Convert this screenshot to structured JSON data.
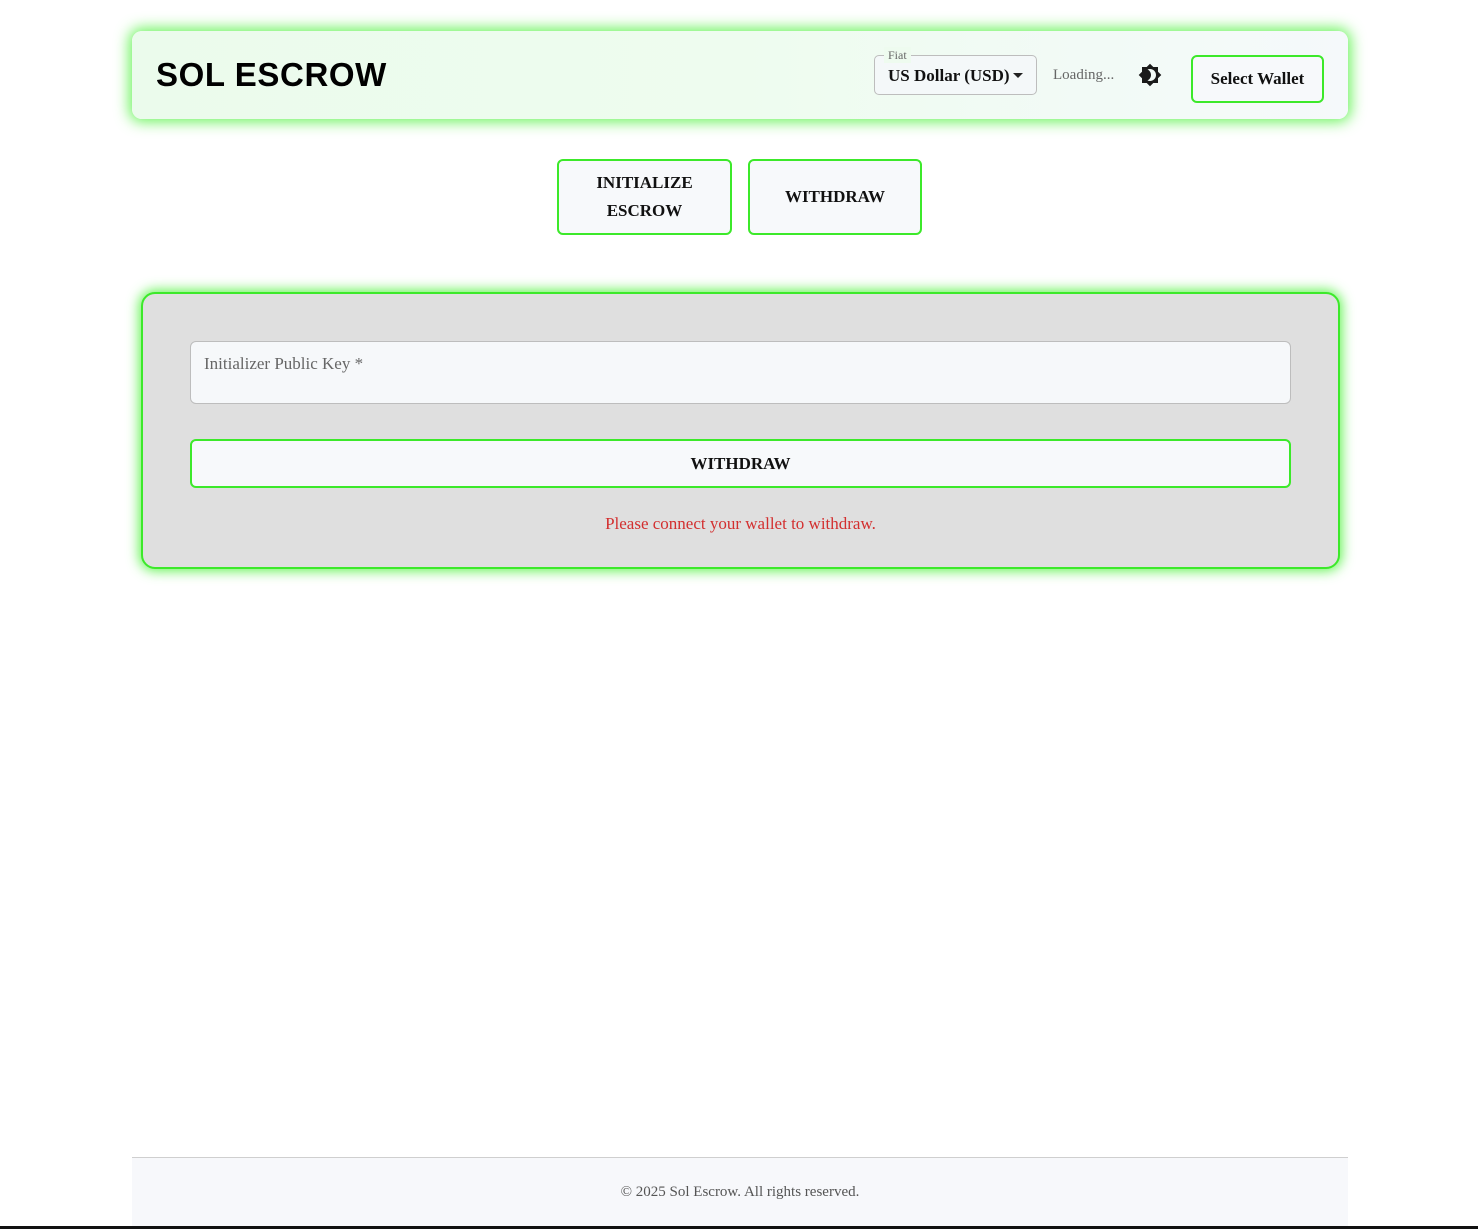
{
  "header": {
    "brand": "SOL ESCROW",
    "fiat": {
      "label": "Fiat",
      "selected": "US Dollar (USD)"
    },
    "price_status": "Loading...",
    "theme_toggle_icon": "brightness-icon",
    "select_wallet_label": "Select Wallet"
  },
  "tabs": [
    {
      "label": "INITIALIZE ESCROW"
    },
    {
      "label": "WITHDRAW"
    }
  ],
  "withdraw_form": {
    "pubkey_placeholder": "Initializer Public Key *",
    "pubkey_value": "",
    "submit_label": "WITHDRAW",
    "error_message": "Please connect your wallet to withdraw."
  },
  "footer": {
    "copyright": "© 2025 Sol Escrow. All rights reserved."
  },
  "colors": {
    "accent": "#3ce92a",
    "error": "#d32f2f",
    "card_background": "#dfdfdf"
  }
}
